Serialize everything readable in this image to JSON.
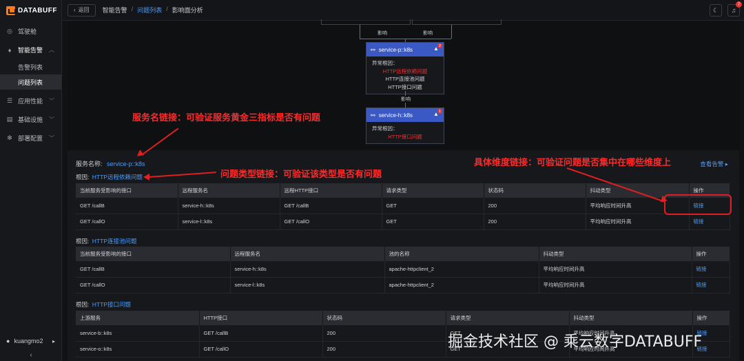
{
  "app": {
    "logo": "DATABUFF"
  },
  "sidebar": {
    "items": [
      {
        "label": "驾驶舱",
        "icon": "dashboard-icon"
      },
      {
        "label": "智能告警",
        "icon": "bell-icon",
        "expanded": true
      },
      {
        "label": "应用性能",
        "icon": "application-icon"
      },
      {
        "label": "基础设施",
        "icon": "infrastructure-icon"
      },
      {
        "label": "部署配置",
        "icon": "gear-icon"
      }
    ],
    "subitems": [
      {
        "label": "告警列表",
        "active": false
      },
      {
        "label": "问题列表",
        "active": true
      }
    ],
    "user": "kuangmo2"
  },
  "topbar": {
    "back": "返回",
    "breadcrumb": [
      "智能告警",
      "问题列表",
      "影响面分析"
    ]
  },
  "graph": {
    "edge_label": "影响",
    "nodes": [
      {
        "name": "service-p::k8s",
        "badge": "2",
        "abnormal_label": "异常根因：",
        "causes": [
          {
            "text": "HTTP远程依赖问题",
            "red": true
          },
          {
            "text": "HTTP连接池问题",
            "red": false
          },
          {
            "text": "HTTP接口问题",
            "red": false
          }
        ]
      },
      {
        "name": "service-h::k8s",
        "badge": "1",
        "abnormal_label": "异常根因：",
        "causes": [
          {
            "text": "HTTP接口问题",
            "red": true
          }
        ]
      }
    ]
  },
  "annotations": {
    "service_link": "服务名链接：可验证服务黄金三指标是否有问题",
    "type_link": "问题类型链接：可验证该类型是否有问题",
    "dimension_link": "具体维度链接：可验证问题是否集中在哪些维度上"
  },
  "detail": {
    "service_label": "服务名称:",
    "service_value": "service-p::k8s",
    "see_alert": "查看告警",
    "root_label": "根因:",
    "sections": [
      {
        "root": "HTTP远程依赖问题",
        "columns": [
          "当前服务受影响的接口",
          "远程服务名",
          "远程HTTP接口",
          "请求类型",
          "状态码",
          "抖动类型",
          "操作"
        ],
        "rows": [
          [
            "GET /callB",
            "service-h::k8s",
            "GET /callB",
            "GET",
            "200",
            "平均响应时间升高",
            "链接"
          ],
          [
            "GET /callO",
            "service-l::k8s",
            "GET /callO",
            "GET",
            "200",
            "平均响应时间升高",
            "链接"
          ]
        ]
      },
      {
        "root": "HTTP连接池问题",
        "columns": [
          "当前服务受影响的接口",
          "远程服务名",
          "池的名称",
          "抖动类型",
          "操作"
        ],
        "rows": [
          [
            "GET /callB",
            "service-h::k8s",
            "apache-httpclient_2",
            "平均响应时间升高",
            "链接"
          ],
          [
            "GET /callO",
            "service-l::k8s",
            "apache-httpclient_2",
            "平均响应时间升高",
            "链接"
          ]
        ]
      },
      {
        "root": "HTTP接口问题",
        "columns": [
          "上游服务",
          "HTTP接口",
          "状态码",
          "请求类型",
          "抖动类型",
          "操作"
        ],
        "rows": [
          [
            "service-b::k8s",
            "GET /callB",
            "200",
            "GET",
            "平均响应时间升高",
            "链接"
          ],
          [
            "service-o::k8s",
            "GET /callO",
            "200",
            "GET",
            "平均响应时间升高",
            "链接"
          ]
        ]
      }
    ]
  },
  "watermark": "掘金技术社区 @ 乘云数字DATABUFF",
  "colors": {
    "accent": "#4e9cf5",
    "node_header": "#3b59c4",
    "alert_red": "#e53535",
    "logo": "#ff7a1a"
  }
}
